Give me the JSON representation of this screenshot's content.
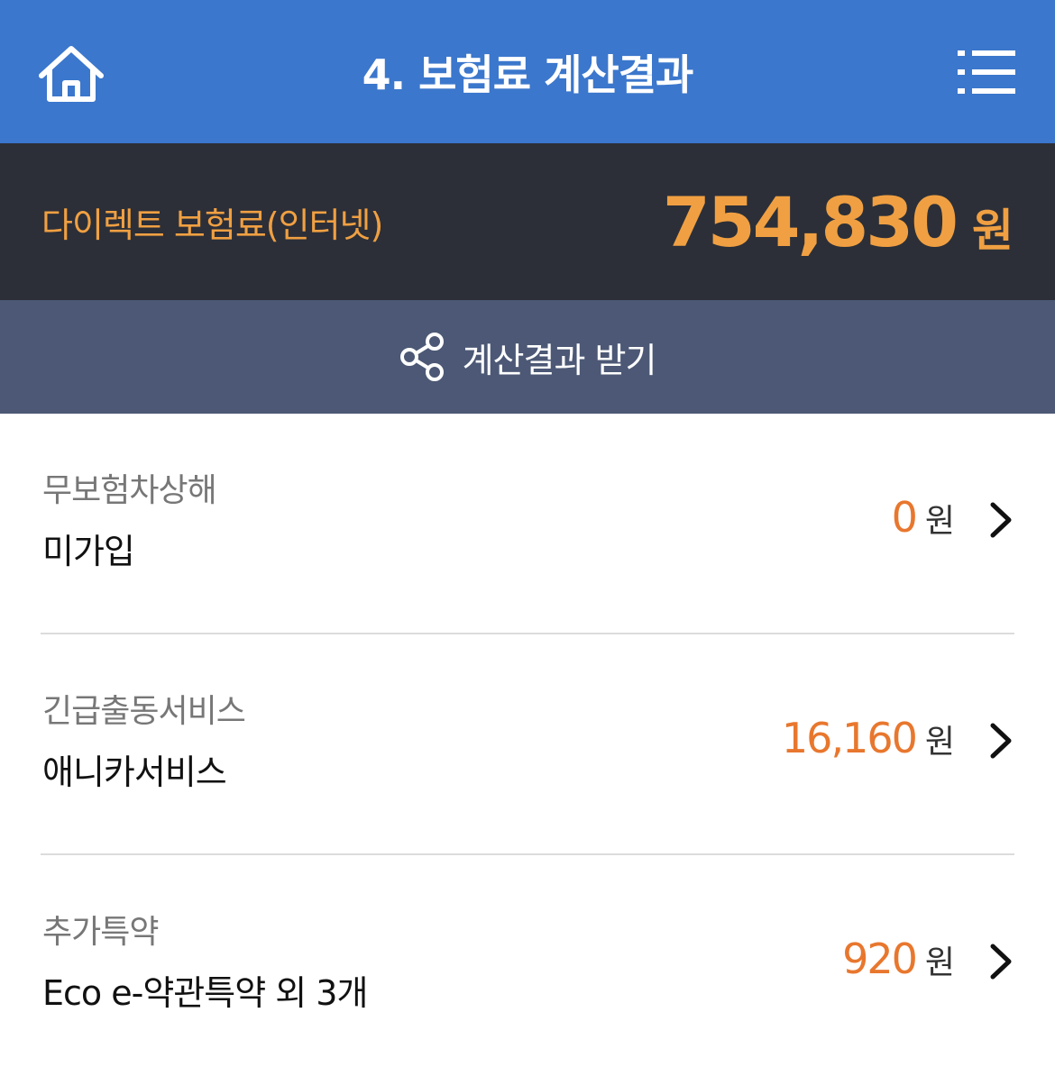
{
  "header": {
    "title": "4. 보험료 계산결과",
    "home_icon": "home-icon",
    "menu_icon": "list-menu-icon"
  },
  "premium": {
    "label": "다이렉트 보험료(인터넷)",
    "amount": "754,830",
    "unit": "원"
  },
  "share": {
    "icon": "share-icon",
    "label": "계산결과 받기"
  },
  "items": [
    {
      "category": "무보험차상해",
      "value": "미가입",
      "price": "0",
      "unit": "원"
    },
    {
      "category": "긴급출동서비스",
      "value": "애니카서비스",
      "price": "16,160",
      "unit": "원"
    },
    {
      "category": "추가특약",
      "value": "Eco e-약관특약 외 3개",
      "price": "920",
      "unit": "원"
    }
  ],
  "colors": {
    "header_bg": "#3b77cc",
    "premium_bg": "#2c2f38",
    "premium_accent": "#f0a042",
    "share_bg": "#4c5875",
    "price_accent": "#e8772e"
  }
}
